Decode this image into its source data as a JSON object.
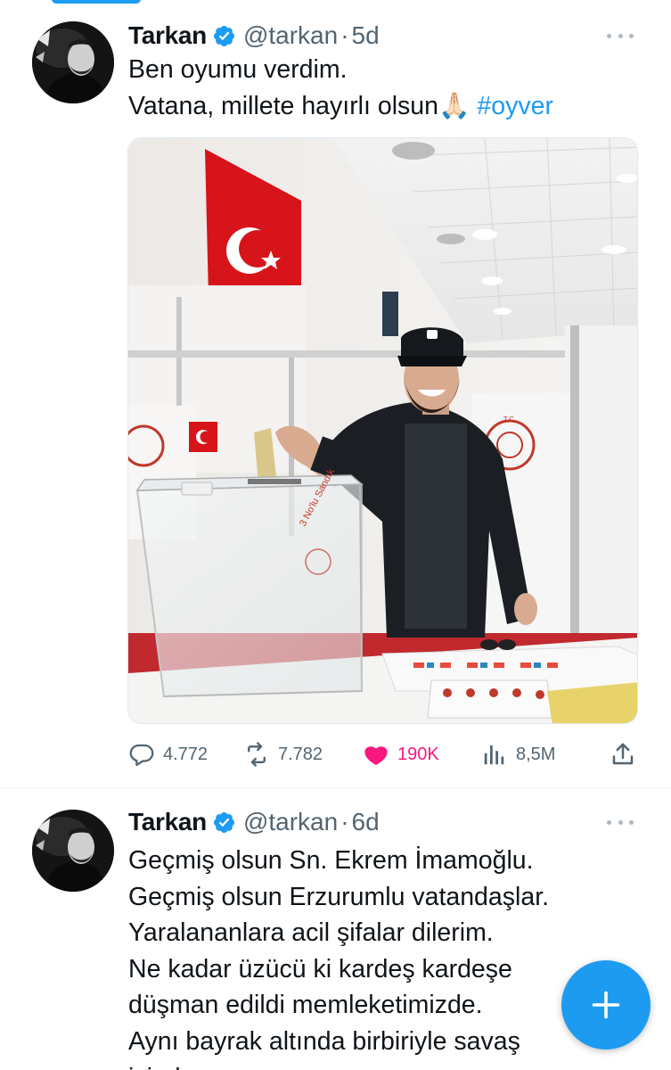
{
  "tweets": [
    {
      "author_name": "Tarkan",
      "handle": "@tarkan",
      "separator": "·",
      "time": "5d",
      "lines": [
        "Ben oyumu verdim.",
        "Vatana, millete hayırlı olsun"
      ],
      "emoji": "🙏🏻",
      "hashtag": "#oyver",
      "media": {
        "ballot_box_label": "3 No'lu Sandık",
        "emblem_text": "T.C."
      },
      "stats": {
        "replies": "4.772",
        "retweets": "7.782",
        "likes": "190K",
        "views": "8,5M"
      }
    },
    {
      "author_name": "Tarkan",
      "handle": "@tarkan",
      "separator": "·",
      "time": "6d",
      "lines": [
        "Geçmiş olsun Sn. Ekrem İmamoğlu.",
        "Geçmiş olsun Erzurumlu vatandaşlar.",
        "Yaralananlara acil şifalar dilerim.",
        "Ne kadar üzücü ki kardeş kardeşe",
        "düşman edildi memleketimizde.",
        "Aynı bayrak altında birbiriyle savaş",
        "içinde"
      ]
    }
  ],
  "icons": {
    "verified": "verified-badge-icon",
    "more": "more-options-icon",
    "reply": "reply-icon",
    "retweet": "retweet-icon",
    "like": "heart-icon",
    "views": "views-icon",
    "share": "share-icon",
    "compose": "plus-icon"
  },
  "colors": {
    "accent": "#1d9bf0",
    "like": "#f91880",
    "secondary_text": "#536471"
  }
}
